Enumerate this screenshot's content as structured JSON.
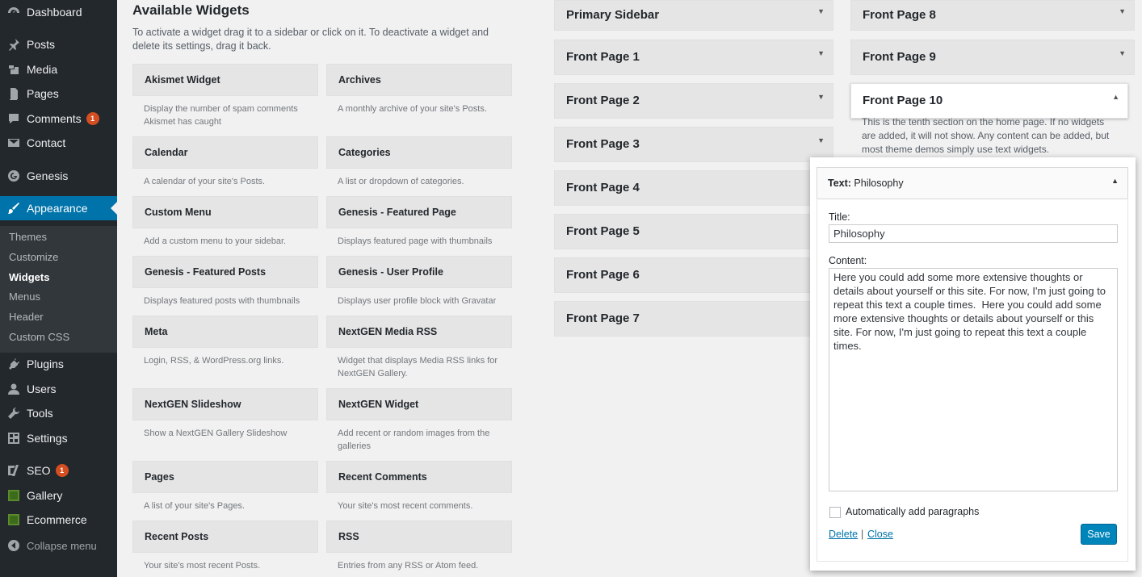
{
  "admin_menu": {
    "items": [
      {
        "label": "Dashboard",
        "icon": "dashboard-icon"
      },
      {
        "label": "Posts",
        "icon": "pin-icon"
      },
      {
        "label": "Media",
        "icon": "media-icon"
      },
      {
        "label": "Pages",
        "icon": "page-icon"
      },
      {
        "label": "Comments",
        "icon": "comment-icon",
        "badge": "1"
      },
      {
        "label": "Contact",
        "icon": "mail-icon"
      },
      {
        "label": "Genesis",
        "icon": "genesis-icon"
      },
      {
        "label": "Appearance",
        "icon": "brush-icon"
      },
      {
        "label": "Plugins",
        "icon": "plug-icon"
      },
      {
        "label": "Users",
        "icon": "user-icon"
      },
      {
        "label": "Tools",
        "icon": "wrench-icon"
      },
      {
        "label": "Settings",
        "icon": "settings-icon"
      },
      {
        "label": "SEO",
        "icon": "seo-icon",
        "badge": "1"
      },
      {
        "label": "Gallery",
        "icon": "gallery-icon"
      },
      {
        "label": "Ecommerce",
        "icon": "ecommerce-icon"
      },
      {
        "label": "Collapse menu",
        "icon": "collapse-icon"
      }
    ],
    "submenu": [
      "Themes",
      "Customize",
      "Widgets",
      "Menus",
      "Header",
      "Custom CSS"
    ],
    "accent": "#0073aa"
  },
  "available": {
    "title": "Available Widgets",
    "description": "To activate a widget drag it to a sidebar or click on it. To deactivate a widget and delete its settings, drag it back.",
    "widgets": [
      {
        "name": "Akismet Widget",
        "desc": "Display the number of spam comments Akismet has caught"
      },
      {
        "name": "Archives",
        "desc": "A monthly archive of your site's Posts."
      },
      {
        "name": "Calendar",
        "desc": "A calendar of your site's Posts."
      },
      {
        "name": "Categories",
        "desc": "A list or dropdown of categories."
      },
      {
        "name": "Custom Menu",
        "desc": "Add a custom menu to your sidebar."
      },
      {
        "name": "Genesis - Featured Page",
        "desc": "Displays featured page with thumbnails"
      },
      {
        "name": "Genesis - Featured Posts",
        "desc": "Displays featured posts with thumbnails"
      },
      {
        "name": "Genesis - User Profile",
        "desc": "Displays user profile block with Gravatar"
      },
      {
        "name": "Meta",
        "desc": "Login, RSS, & WordPress.org links."
      },
      {
        "name": "NextGEN Media RSS",
        "desc": "Widget that displays Media RSS links for NextGEN Gallery."
      },
      {
        "name": "NextGEN Slideshow",
        "desc": "Show a NextGEN Gallery Slideshow"
      },
      {
        "name": "NextGEN Widget",
        "desc": "Add recent or random images from the galleries"
      },
      {
        "name": "Pages",
        "desc": "A list of your site's Pages."
      },
      {
        "name": "Recent Comments",
        "desc": "Your site's most recent comments."
      },
      {
        "name": "Recent Posts",
        "desc": "Your site's most recent Posts."
      },
      {
        "name": "RSS",
        "desc": "Entries from any RSS or Atom feed."
      }
    ]
  },
  "sidebars": {
    "left": [
      "Primary Sidebar",
      "Front Page 1",
      "Front Page 2",
      "Front Page 3",
      "Front Page 4",
      "Front Page 5",
      "Front Page 6",
      "Front Page 7"
    ],
    "right": [
      "Front Page 8",
      "Front Page 9",
      "Front Page 10"
    ],
    "open_description": "This is the tenth section on the home page. If no widgets are added, it will not show. Any content can be added, but most theme demos simply use text widgets."
  },
  "text_widget": {
    "type_label": "Text:",
    "name": "Philosophy",
    "title_label": "Title:",
    "title_value": "Philosophy",
    "content_label": "Content:",
    "content_value": "Here you could add some more extensive thoughts or details about yourself or this site. For now, I'm just going to repeat this text a couple times.  Here you could add some more extensive thoughts or details about yourself or this site. For now, I'm just going to repeat this text a couple times.",
    "auto_paragraphs_label": "Automatically add paragraphs",
    "delete_label": "Delete",
    "separator": "|",
    "close_label": "Close",
    "save_label": "Save"
  }
}
